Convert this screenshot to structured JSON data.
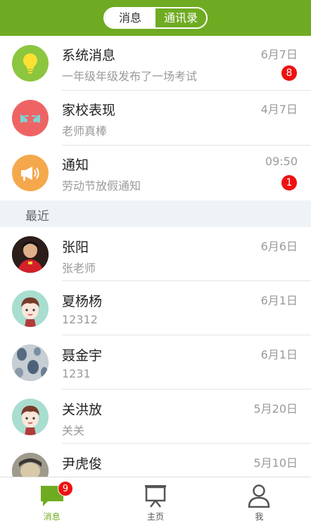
{
  "header": {
    "tabs": [
      {
        "label": "消息",
        "active": true
      },
      {
        "label": "通讯录",
        "active": false
      }
    ],
    "color": "#6fab22"
  },
  "system_items": [
    {
      "name": "系统消息",
      "preview": "一年级年级发布了一场考试",
      "time": "6月7日",
      "badge": "8",
      "icon": "lightbulb-icon",
      "icon_bg": "#8cc63f"
    },
    {
      "name": "家校表现",
      "preview": "老师真棒",
      "time": "4月7日",
      "badge": "",
      "icon": "star-ribbon-icon",
      "icon_bg": "#ee6464"
    },
    {
      "name": "通知",
      "preview": "劳动节放假通知",
      "time": "09:50",
      "badge": "1",
      "icon": "megaphone-icon",
      "icon_bg": "#f5a84b"
    }
  ],
  "section_label": "最近",
  "contacts": [
    {
      "name": "张阳",
      "preview": "张老师",
      "time": "6月6日",
      "avatar": "photo-avatar"
    },
    {
      "name": "夏杨杨",
      "preview": "12312",
      "time": "6月1日",
      "avatar": "cartoon-boy-avatar"
    },
    {
      "name": "聂金宇",
      "preview": "1231",
      "time": "6月1日",
      "avatar": "pattern-avatar"
    },
    {
      "name": "关洪放",
      "preview": "关关",
      "time": "5月20日",
      "avatar": "cartoon-boy-avatar"
    },
    {
      "name": "尹虎俊",
      "preview": "",
      "time": "5月10日",
      "avatar": "photo-avatar"
    }
  ],
  "tabbar": {
    "items": [
      {
        "label": "消息",
        "icon": "chat-bubble-icon",
        "active": true,
        "badge": "9"
      },
      {
        "label": "主页",
        "icon": "presentation-board-icon",
        "active": false
      },
      {
        "label": "我",
        "icon": "person-icon",
        "active": false
      }
    ]
  }
}
